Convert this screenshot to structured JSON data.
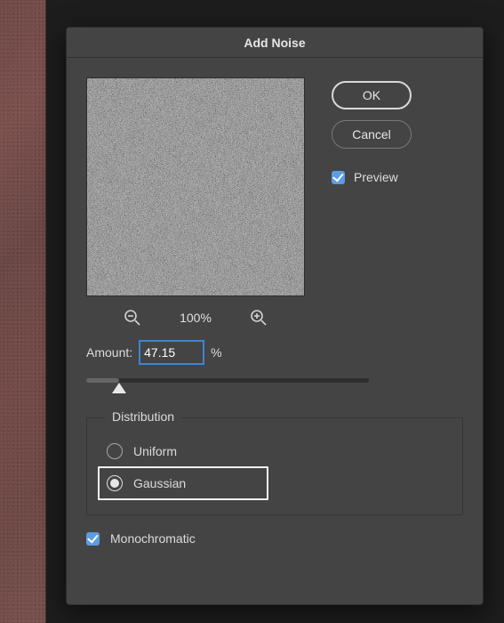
{
  "dialog": {
    "title": "Add Noise",
    "buttons": {
      "ok": "OK",
      "cancel": "Cancel"
    },
    "preview_label": "Preview",
    "preview_checked": true,
    "zoom_level": "100%",
    "amount": {
      "label": "Amount:",
      "value": "47.15",
      "unit": "%",
      "slider_min": 0,
      "slider_max": 400
    },
    "distribution": {
      "legend": "Distribution",
      "options": {
        "uniform": "Uniform",
        "gaussian": "Gaussian"
      },
      "selected": "gaussian"
    },
    "monochromatic": {
      "label": "Monochromatic",
      "checked": true
    }
  }
}
